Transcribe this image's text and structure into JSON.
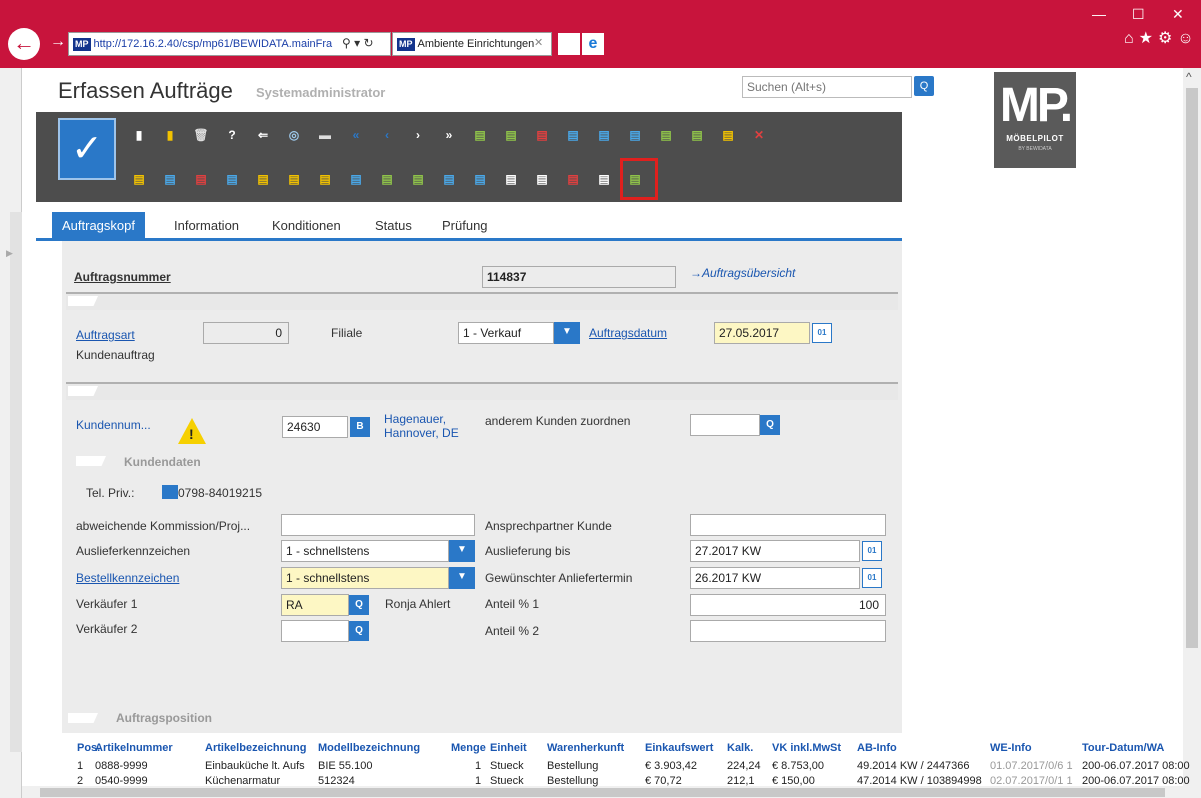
{
  "browser": {
    "url": "http://172.16.2.40/csp/mp61/BEWIDATA.mainFra",
    "tab_title": "Ambiente Einrichtungen",
    "logo_text": "MP"
  },
  "header": {
    "title": "Erfassen Aufträge",
    "user": "Systemadministrator",
    "search_placeholder": "Suchen (Alt+s)"
  },
  "brand": {
    "big": "MP.",
    "name": "MÖBELPILOT",
    "sub": "BY BEWIDATA"
  },
  "tabs": [
    "Auftragskopf",
    "Information",
    "Konditionen",
    "Status",
    "Prüfung"
  ],
  "order": {
    "number_label": "Auftragsnummer",
    "number_value": "114837",
    "overview_link": "→Auftragsübersicht",
    "type_label": "Auftragsart",
    "type_value": "0",
    "type_text": "Kundenauftrag",
    "branch_label": "Filiale",
    "branch_value": "1 - Verkauf",
    "date_label": "Auftragsdatum",
    "date_value": "27.05.2017"
  },
  "customer": {
    "number_label": "Kundennum...",
    "number_value": "24630",
    "b_button": "B",
    "name_line1": "Hagenauer,",
    "name_line2": "Hannover, DE",
    "assign_label": "anderem Kunden zuordnen",
    "section_label": "Kundendaten",
    "tel_label": "Tel. Priv.:",
    "tel_value": "0798-84019215"
  },
  "form": {
    "commission_label": "abweichende Kommission/Proj...",
    "contact_label": "Ansprechpartner Kunde",
    "delivery_flag_label": "Auslieferkennzeichen",
    "delivery_flag_value": "1 - schnellstens",
    "delivery_until_label": "Auslieferung bis",
    "delivery_until_value": "27.2017 KW",
    "order_flag_label": "Bestellkennzeichen",
    "order_flag_value": "1 - schnellstens",
    "desired_date_label": "Gewünschter Anliefertermin",
    "desired_date_value": "26.2017 KW",
    "seller1_label": "Verkäufer 1",
    "seller1_value": "RA",
    "seller1_name": "Ronja Ahlert",
    "share1_label": "Anteil % 1",
    "share1_value": "100",
    "seller2_label": "Verkäufer 2",
    "share2_label": "Anteil % 2"
  },
  "positions": {
    "section_label": "Auftragsposition",
    "columns": [
      "Pos.",
      "Artikelnummer",
      "Artikelbezeichnung",
      "Modellbezeichnung",
      "Menge",
      "Einheit",
      "Warenherkunft",
      "Einkaufswert",
      "Kalk.",
      "VK inkl.MwSt",
      "AB-Info",
      "WE-Info",
      "Tour-Datum/WA"
    ],
    "rows": [
      [
        "1",
        "0888-9999",
        "Einbauküche lt. Aufs",
        "BIE 55.100",
        "1",
        "Stueck",
        "Bestellung",
        "€ 3.903,42",
        "224,24",
        "€ 8.753,00",
        "49.2014 KW / 2447366",
        "01.07.2017/0/6 1",
        "200-06.07.2017 08:00"
      ],
      [
        "2",
        "0540-9999",
        "Küchenarmatur",
        "512324",
        "1",
        "Stueck",
        "Bestellung",
        "€ 70,72",
        "212,1",
        "€ 150,00",
        "47.2014 KW / 103894998",
        "02.07.2017/0/1 1",
        "200-06.07.2017 08:00"
      ]
    ]
  },
  "colors": {
    "accent": "#2a78c8",
    "titlebar": "#c8143c",
    "highlight": "#e0201e"
  }
}
